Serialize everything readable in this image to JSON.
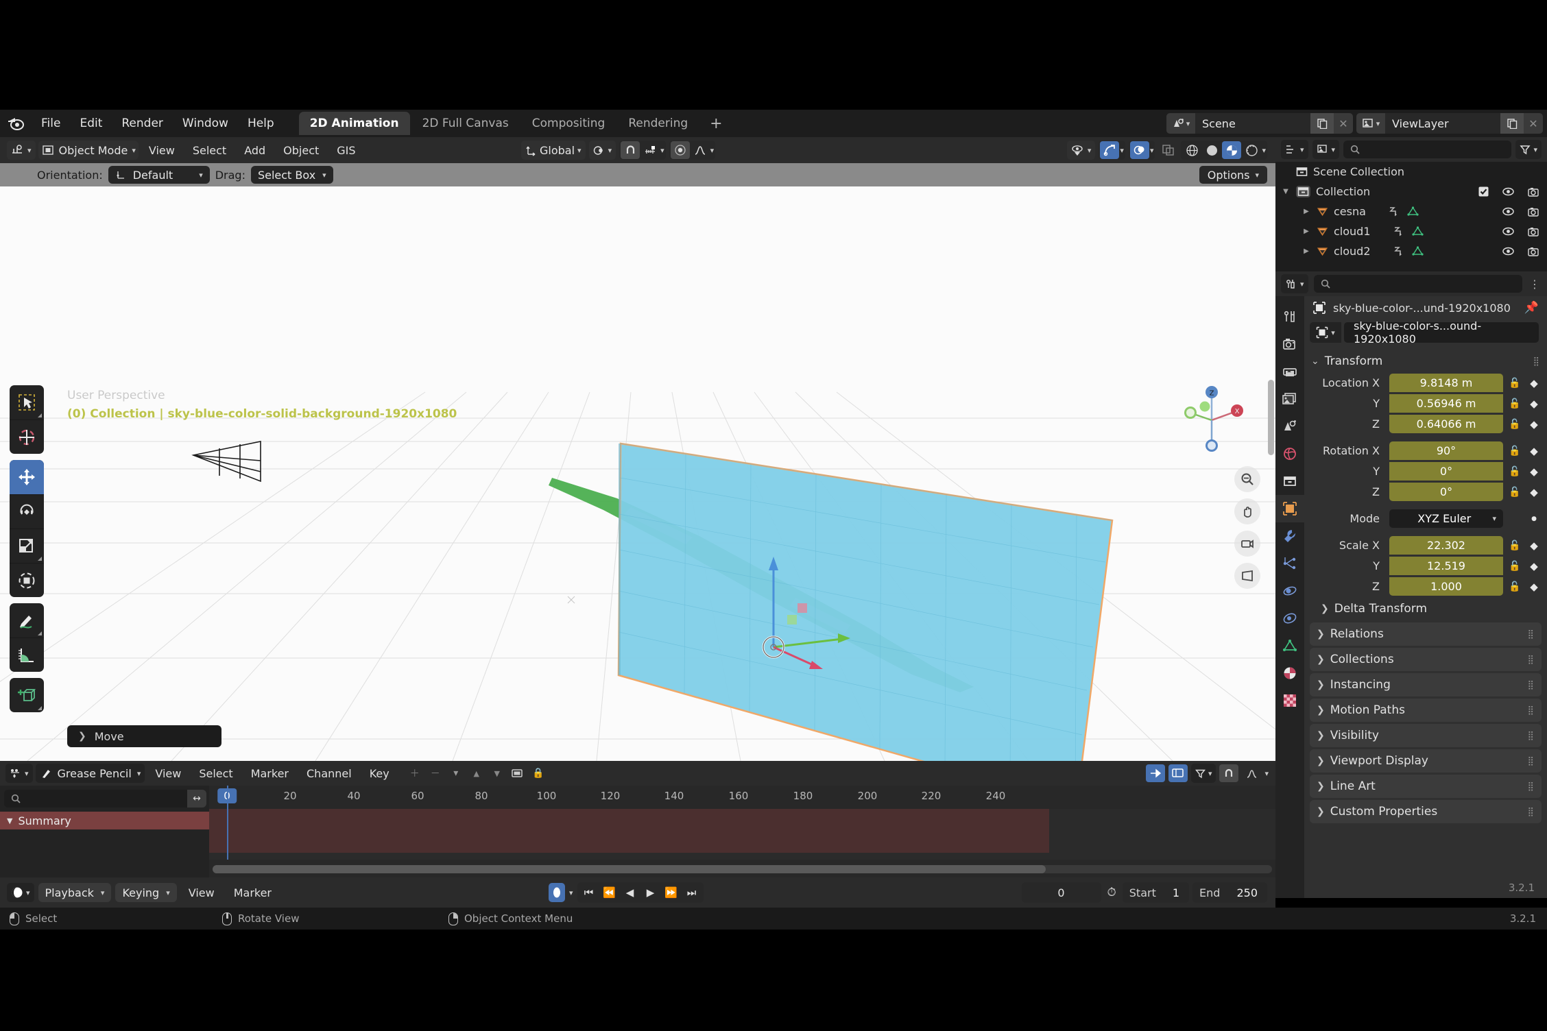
{
  "app": {
    "version": "3.2.1",
    "accent_blue": "#4772b3",
    "prop_yellow": "#838232",
    "viewport_bg": "#fbfbfb",
    "plane_fill": "#7fcfe8",
    "plane_outline": "#e8a87c"
  },
  "topbar": {
    "menus": [
      "File",
      "Edit",
      "Render",
      "Window",
      "Help"
    ],
    "workspaces": [
      {
        "label": "2D Animation",
        "active": true
      },
      {
        "label": "2D Full Canvas",
        "active": false
      },
      {
        "label": "Compositing",
        "active": false
      },
      {
        "label": "Rendering",
        "active": false
      }
    ],
    "add_workspace": "+",
    "scene_name": "Scene",
    "view_layer_name": "ViewLayer"
  },
  "viewport_header": {
    "mode": "Object Mode",
    "menus": [
      "View",
      "Select",
      "Add",
      "Object",
      "GIS"
    ],
    "transform_orientation": "Global",
    "snap_enabled": false,
    "proportional_edit": false
  },
  "tool_settings": {
    "orientation_label": "Orientation:",
    "orientation_value": "Default",
    "drag_label": "Drag:",
    "drag_value": "Select Box",
    "options_label": "Options"
  },
  "viewport": {
    "perspective_text": "User Perspective",
    "collection_text": "(0) Collection | sky-blue-color-solid-background-1920x1080",
    "operator_panel": "Move",
    "gizmo_axes": [
      "X",
      "Y",
      "Z"
    ],
    "tools": [
      {
        "name": "tweak-tool",
        "label": "Tweak",
        "active": false
      },
      {
        "name": "cursor-tool",
        "label": "Cursor",
        "active": false
      },
      {
        "name": "move-tool",
        "label": "Move",
        "active": true
      },
      {
        "name": "rotate-tool",
        "label": "Rotate",
        "active": false
      },
      {
        "name": "scale-tool",
        "label": "Scale",
        "active": false
      },
      {
        "name": "transform-tool",
        "label": "Transform",
        "active": false
      },
      {
        "name": "annotate-tool",
        "label": "Annotate",
        "active": false
      },
      {
        "name": "measure-tool",
        "label": "Measure",
        "active": false
      },
      {
        "name": "add-cube-tool",
        "label": "Add Cube",
        "active": false
      }
    ]
  },
  "outliner": {
    "display_mode": "View Layer",
    "search_placeholder": "",
    "root": "Scene Collection",
    "items": [
      {
        "label": "Collection",
        "depth": 1,
        "type": "collection",
        "expanded": true,
        "checkbox": true,
        "eye": true,
        "camera": true
      },
      {
        "label": "cesna",
        "depth": 2,
        "type": "object",
        "expanded": false,
        "eye": true,
        "camera": true
      },
      {
        "label": "cloud1",
        "depth": 2,
        "type": "object",
        "expanded": false,
        "eye": true,
        "camera": true
      },
      {
        "label": "cloud2",
        "depth": 2,
        "type": "object",
        "expanded": false,
        "eye": true,
        "camera": true
      }
    ]
  },
  "properties": {
    "search_placeholder": "",
    "breadcrumb": "sky-blue-color-...und-1920x1080",
    "object_id_name": "sky-blue-color-s...ound-1920x1080",
    "tabs": [
      {
        "name": "tool",
        "active": false
      },
      {
        "name": "render",
        "active": false
      },
      {
        "name": "output",
        "active": false
      },
      {
        "name": "view-layer",
        "active": false
      },
      {
        "name": "scene",
        "active": false
      },
      {
        "name": "world",
        "active": false
      },
      {
        "name": "collection",
        "active": false
      },
      {
        "name": "object",
        "active": true
      },
      {
        "name": "modifiers",
        "active": false
      },
      {
        "name": "particles",
        "active": false
      },
      {
        "name": "physics",
        "active": false
      },
      {
        "name": "constraints",
        "active": false
      },
      {
        "name": "object-data",
        "active": false
      },
      {
        "name": "material",
        "active": false
      },
      {
        "name": "texture",
        "active": false
      }
    ],
    "transform": {
      "title": "Transform",
      "location_label": "Location X",
      "location": [
        {
          "axis": "X",
          "value": "9.8148 m"
        },
        {
          "axis": "Y",
          "value": "0.56946 m"
        },
        {
          "axis": "Z",
          "value": "0.64066 m"
        }
      ],
      "rotation_label": "Rotation X",
      "rotation": [
        {
          "axis": "X",
          "value": "90°"
        },
        {
          "axis": "Y",
          "value": "0°"
        },
        {
          "axis": "Z",
          "value": "0°"
        }
      ],
      "mode_label": "Mode",
      "mode_value": "XYZ Euler",
      "scale_label": "Scale X",
      "scale": [
        {
          "axis": "X",
          "value": "22.302"
        },
        {
          "axis": "Y",
          "value": "12.519"
        },
        {
          "axis": "Z",
          "value": "1.000"
        }
      ],
      "delta_transform": "Delta Transform"
    },
    "panels": [
      "Relations",
      "Collections",
      "Instancing",
      "Motion Paths",
      "Visibility",
      "Viewport Display",
      "Line Art",
      "Custom Properties"
    ]
  },
  "dopesheet": {
    "mode": "Grease Pencil",
    "menus": [
      "View",
      "Select",
      "Marker",
      "Channel",
      "Key"
    ],
    "search_placeholder": "",
    "summary_label": "Summary",
    "ruler_ticks": [
      0,
      20,
      40,
      60,
      80,
      100,
      120,
      140,
      160,
      180,
      200,
      220,
      240
    ],
    "current_frame_badge": "0"
  },
  "timeline_footer": {
    "playback_label": "Playback",
    "keying_label": "Keying",
    "menus": [
      "View",
      "Marker"
    ],
    "current_frame": "0",
    "start_label": "Start",
    "start_value": "1",
    "end_label": "End",
    "end_value": "250"
  },
  "statusbar": {
    "items": [
      {
        "button": "left",
        "label": "Select"
      },
      {
        "button": "middle",
        "label": "Rotate View"
      },
      {
        "button": "right",
        "label": "Object Context Menu"
      }
    ],
    "version": "3.2.1"
  }
}
